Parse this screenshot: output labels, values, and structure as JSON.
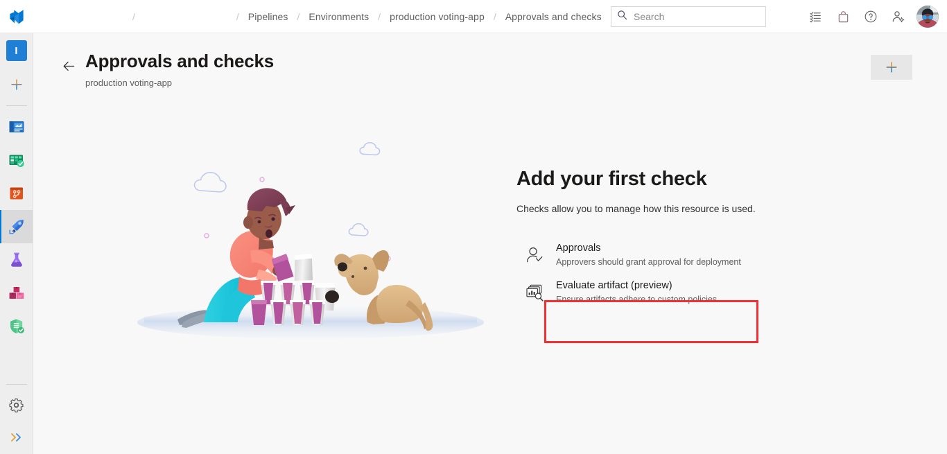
{
  "header": {
    "logo_icon": "azure-devops-logo",
    "breadcrumb": [
      {
        "label": "",
        "redacted": true
      },
      {
        "label": "",
        "redacted": true
      },
      {
        "label": "Pipelines",
        "redacted": false
      },
      {
        "label": "Environments",
        "redacted": false
      },
      {
        "label": "production voting-app",
        "redacted": false
      },
      {
        "label": "Approvals and checks",
        "redacted": false
      }
    ],
    "separator": "/",
    "search": {
      "placeholder": "Search",
      "icon": "search-icon"
    },
    "actions": [
      {
        "name": "tasks-icon",
        "label": "Tasks"
      },
      {
        "name": "marketplace-bag-icon",
        "label": "Marketplace"
      },
      {
        "name": "help-question-icon",
        "label": "Help"
      },
      {
        "name": "user-settings-icon",
        "label": "User settings"
      }
    ],
    "avatar_label": "Profile"
  },
  "rail": {
    "project_initial": "I",
    "new_label": "New",
    "items": [
      {
        "name": "overview",
        "label": "Overview",
        "selected": false,
        "color": "#2b88d8"
      },
      {
        "name": "boards",
        "label": "Boards",
        "selected": false,
        "color": "#13a10e"
      },
      {
        "name": "repos",
        "label": "Repos",
        "selected": false,
        "color": "#e8511c"
      },
      {
        "name": "pipelines",
        "label": "Pipelines",
        "selected": true,
        "color": "#2564cf"
      },
      {
        "name": "test-plans",
        "label": "Test Plans",
        "selected": false,
        "color": "#8661c5"
      },
      {
        "name": "artifacts",
        "label": "Artifacts",
        "selected": false,
        "color": "#d6336c"
      },
      {
        "name": "advanced-security",
        "label": "Advanced Security",
        "selected": false,
        "color": "#5cc98f"
      }
    ],
    "bottom": [
      {
        "name": "project-settings",
        "label": "Project settings",
        "icon": "gear-icon"
      },
      {
        "name": "expand-rail",
        "label": "Expand",
        "icon": "chevron-double-right-icon"
      }
    ]
  },
  "page": {
    "back_label": "Back",
    "title": "Approvals and checks",
    "subtitle": "production voting-app",
    "add_button_label": "Add",
    "add_button_icon": "plus-icon"
  },
  "empty_state": {
    "heading": "Add your first check",
    "description": "Checks allow you to manage how this resource is used.",
    "illustration": "person-stacking-cups-with-dog",
    "options": [
      {
        "icon": "person-check-icon",
        "title": "Approvals",
        "description": "Approvers should grant approval for deployment",
        "highlighted": false
      },
      {
        "icon": "evaluate-artifact-icon",
        "title": "Evaluate artifact (preview)",
        "description": "Ensure artifacts adhere to custom policies",
        "highlighted": true
      }
    ]
  },
  "colors": {
    "accent": "#0078d4",
    "highlight_box": "#f23030",
    "page_background": "#f8f8f8",
    "rail_background": "#eeeeee"
  }
}
